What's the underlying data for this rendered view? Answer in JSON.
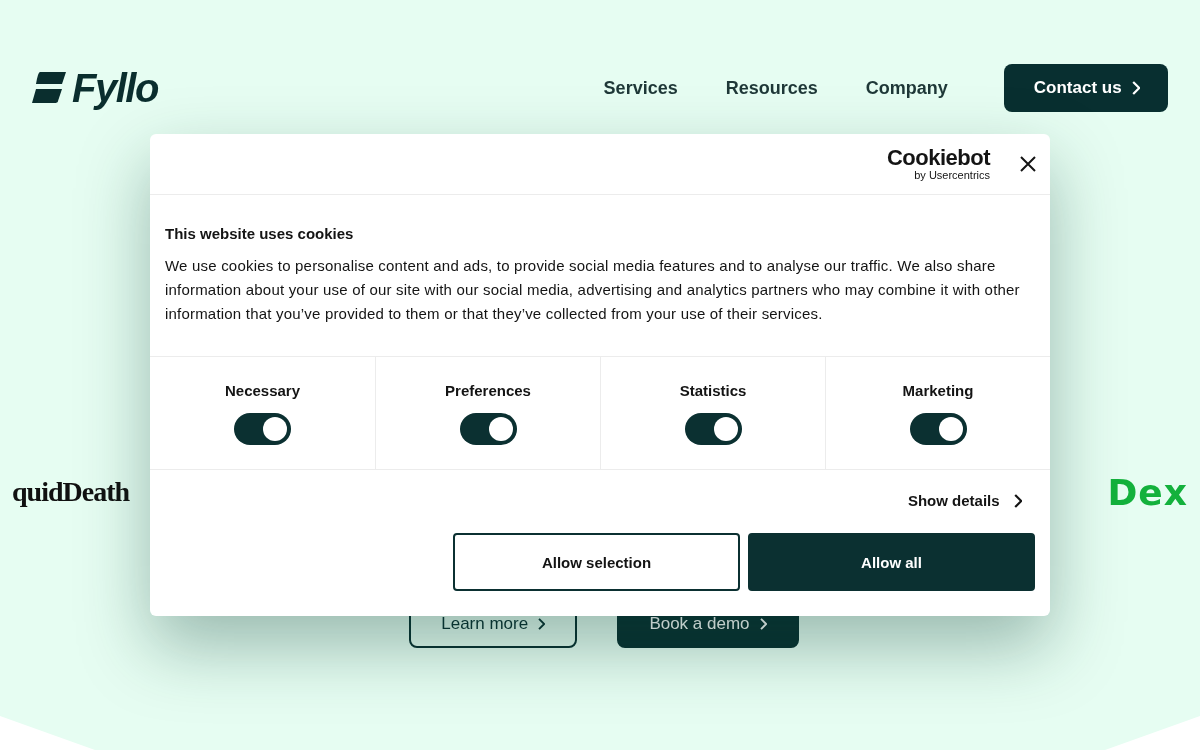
{
  "header": {
    "logo": "Fyllo",
    "nav": [
      "Services",
      "Resources",
      "Company"
    ],
    "cta": "Contact us"
  },
  "logos": [
    {
      "text": "quidDeath",
      "kind": "blackletter"
    },
    {
      "text": "Dex",
      "kind": "green"
    }
  ],
  "hero_buttons": [
    {
      "label": "Learn more",
      "kind": "outline"
    },
    {
      "label": "Book a demo",
      "kind": "solid"
    }
  ],
  "dialog": {
    "brand": "Cookiebot",
    "brand_sub": "by Usercentrics",
    "title": "This website uses cookies",
    "body": "We use cookies to personalise content and ads, to provide social media features and to analyse our traffic. We also share information about your use of our site with our social media, advertising and analytics partners who may combine it with other information that you’ve provided to them or that they’ve collected from your use of their services.",
    "categories": [
      {
        "label": "Necessary",
        "on": true
      },
      {
        "label": "Preferences",
        "on": true
      },
      {
        "label": "Statistics",
        "on": true
      },
      {
        "label": "Marketing",
        "on": true
      }
    ],
    "details_link": "Show details",
    "buttons": [
      {
        "label": "Allow selection",
        "kind": "outline"
      },
      {
        "label": "Allow all",
        "kind": "solid"
      }
    ]
  }
}
